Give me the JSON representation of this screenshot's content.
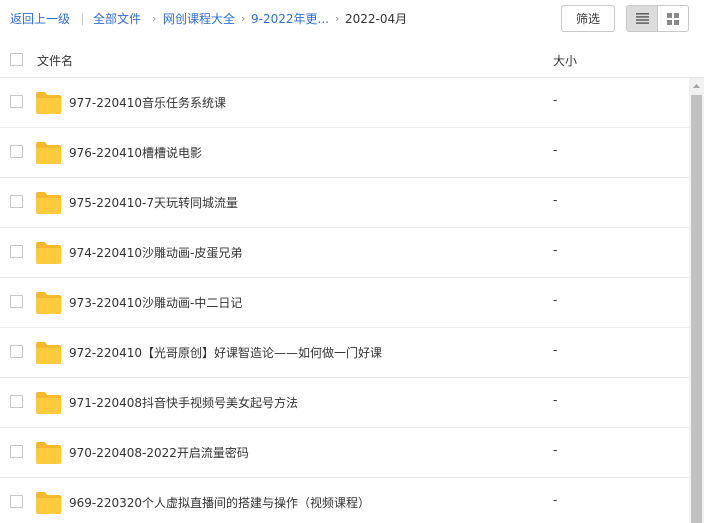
{
  "breadcrumb": {
    "back": "返回上一级",
    "all_files": "全部文件",
    "level1": "网创课程大全",
    "level2": "9-2022年更...",
    "current": "2022-04月"
  },
  "toolbar": {
    "filter_label": "筛选",
    "list_view_icon": "list-view-icon",
    "grid_view_icon": "grid-view-icon"
  },
  "table": {
    "col_name": "文件名",
    "col_size": "大小"
  },
  "files": [
    {
      "name": "977-220410音乐任务系统课",
      "size": "-"
    },
    {
      "name": "976-220410槽槽说电影",
      "size": "-"
    },
    {
      "name": "975-220410-7天玩转同城流量",
      "size": "-"
    },
    {
      "name": "974-220410沙雕动画-皮蛋兄弟",
      "size": "-"
    },
    {
      "name": "973-220410沙雕动画-中二日记",
      "size": "-"
    },
    {
      "name": "972-220410【光哥原创】好课智造论——如何做一门好课",
      "size": "-"
    },
    {
      "name": "971-220408抖音快手视频号美女起号方法",
      "size": "-"
    },
    {
      "name": "970-220408-2022开启流量密码",
      "size": "-"
    },
    {
      "name": "969-220320个人虚拟直播间的搭建与操作（视频课程）",
      "size": "-"
    }
  ],
  "colors": {
    "link": "#2f6fd1",
    "folder": "#ffcb3d",
    "folder_tab": "#f5b92b"
  }
}
